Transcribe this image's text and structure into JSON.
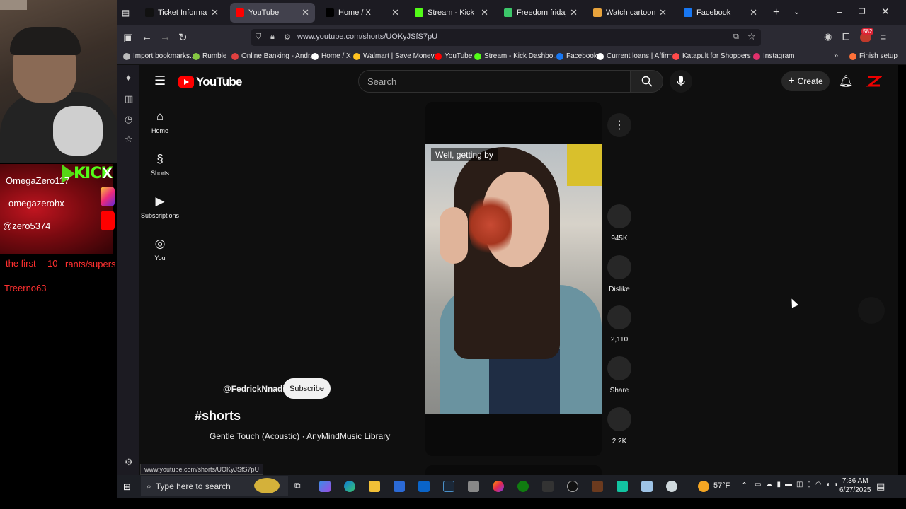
{
  "overlay": {
    "kick_logo": "KICK",
    "x_logo": "X",
    "handle_kick": "OmegaZero117",
    "handle_x": "omegazerohx",
    "handle_ig": "@zero5374",
    "notice": [
      "the first",
      "10",
      "rants/supers"
    ],
    "follower": "Treerno63"
  },
  "browser": {
    "tabs": [
      {
        "label": "Ticket Information - N",
        "favicon_color": "#111111"
      },
      {
        "label": "YouTube",
        "favicon_color": "#ff0000"
      },
      {
        "label": "Home / X",
        "favicon_color": "#000000"
      },
      {
        "label": "Stream - Kick Dashbo",
        "favicon_color": "#53fc18"
      },
      {
        "label": "Freedom friday",
        "favicon_color": "#3cc76a"
      },
      {
        "label": "Watch cartoons online",
        "favicon_color": "#e8a33c"
      },
      {
        "label": "Facebook",
        "favicon_color": "#1877f2"
      }
    ],
    "url": "www.youtube.com/shorts/UOKyJSfS7pU",
    "bookmarks": [
      {
        "label": "Import bookmarks...",
        "color": "#bbbbbb"
      },
      {
        "label": "Rumble",
        "color": "#85c742"
      },
      {
        "label": "Online Banking - Andr...",
        "color": "#e04040"
      },
      {
        "label": "Home / X",
        "color": "#ffffff"
      },
      {
        "label": "Walmart | Save Money...",
        "color": "#ffc220"
      },
      {
        "label": "YouTube",
        "color": "#ff0000"
      },
      {
        "label": "Stream - Kick Dashbo...",
        "color": "#53fc18"
      },
      {
        "label": "Facebook",
        "color": "#1877f2"
      },
      {
        "label": "Current loans | Affirm",
        "color": "#ffffff"
      },
      {
        "label": "Katapult for Shoppers ...",
        "color": "#ff4a4a"
      },
      {
        "label": "Instagram",
        "color": "#e1306c"
      }
    ],
    "finish_setup": "Finish setup",
    "badge_count": "582",
    "status_url": "www.youtube.com/shorts/UOKyJSfS7pU"
  },
  "youtube": {
    "logo_text": "YouTube",
    "search_placeholder": "Search",
    "create_label": "Create",
    "guide": [
      "Home",
      "Shorts",
      "Subscriptions",
      "You"
    ],
    "caption": "Well, getting by",
    "actions": {
      "likes": "945K",
      "dislike": "Dislike",
      "comments": "2,110",
      "share": "Share",
      "remix": "2.2K"
    },
    "channel": "@FedrickNnadi",
    "subscribe": "Subscribe",
    "hashtag": "#shorts",
    "music": "Gentle Touch (Acoustic) · AnyMindMusic Library"
  },
  "taskbar": {
    "search_placeholder": "Type here to search",
    "weather": "57°F",
    "time": "7:36 AM",
    "date": "6/27/2025"
  }
}
